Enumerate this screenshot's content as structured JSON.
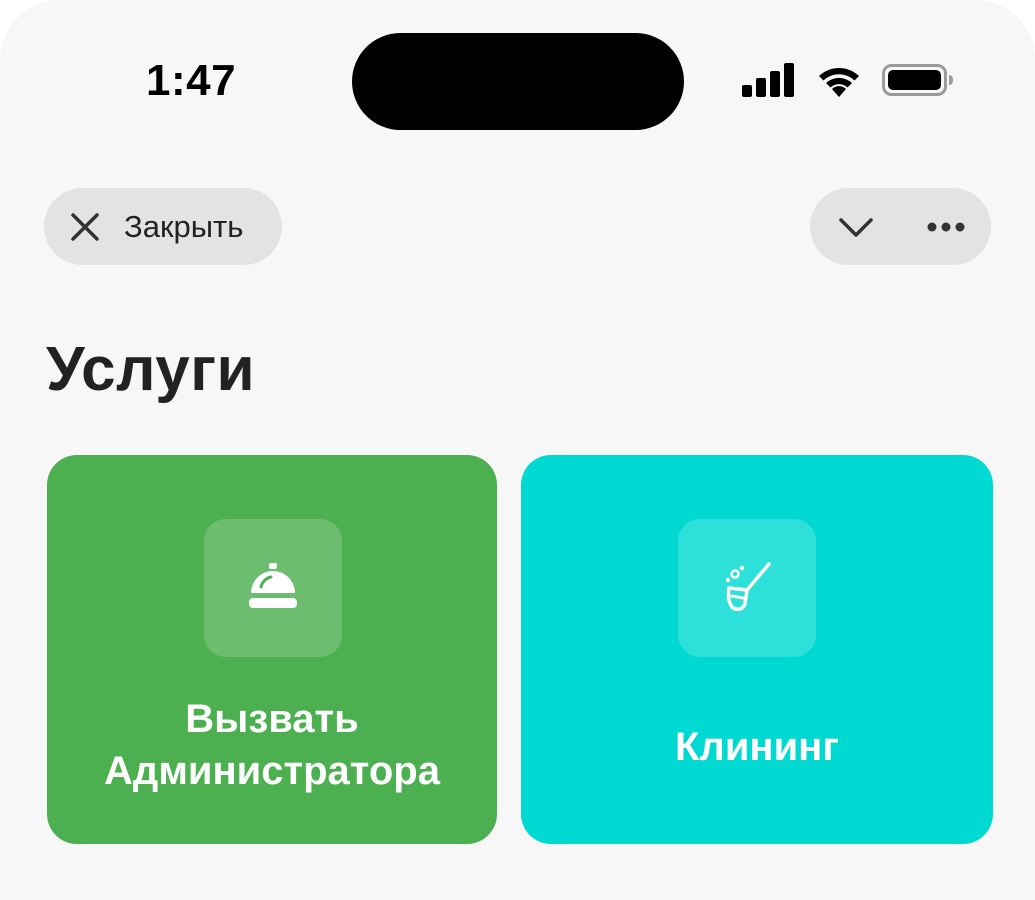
{
  "status_bar": {
    "time": "1:47",
    "icons": [
      "cellular-signal-icon",
      "wifi-icon",
      "battery-icon"
    ]
  },
  "nav": {
    "close_label": "Закрыть",
    "close_icon": "close-icon",
    "collapse_icon": "chevron-down-icon",
    "more_icon": "more-icon"
  },
  "page": {
    "title": "Услуги"
  },
  "services": [
    {
      "label_line1": "Вызвать",
      "label_line2": "Администратора",
      "icon": "service-bell-icon",
      "color": "#4caf50"
    },
    {
      "label_line1": "Клининг",
      "icon": "broom-icon",
      "color": "#00d9d2"
    }
  ],
  "colors": {
    "background": "#f7f7f7",
    "pill": "#e3e3e3",
    "text": "#222222"
  }
}
